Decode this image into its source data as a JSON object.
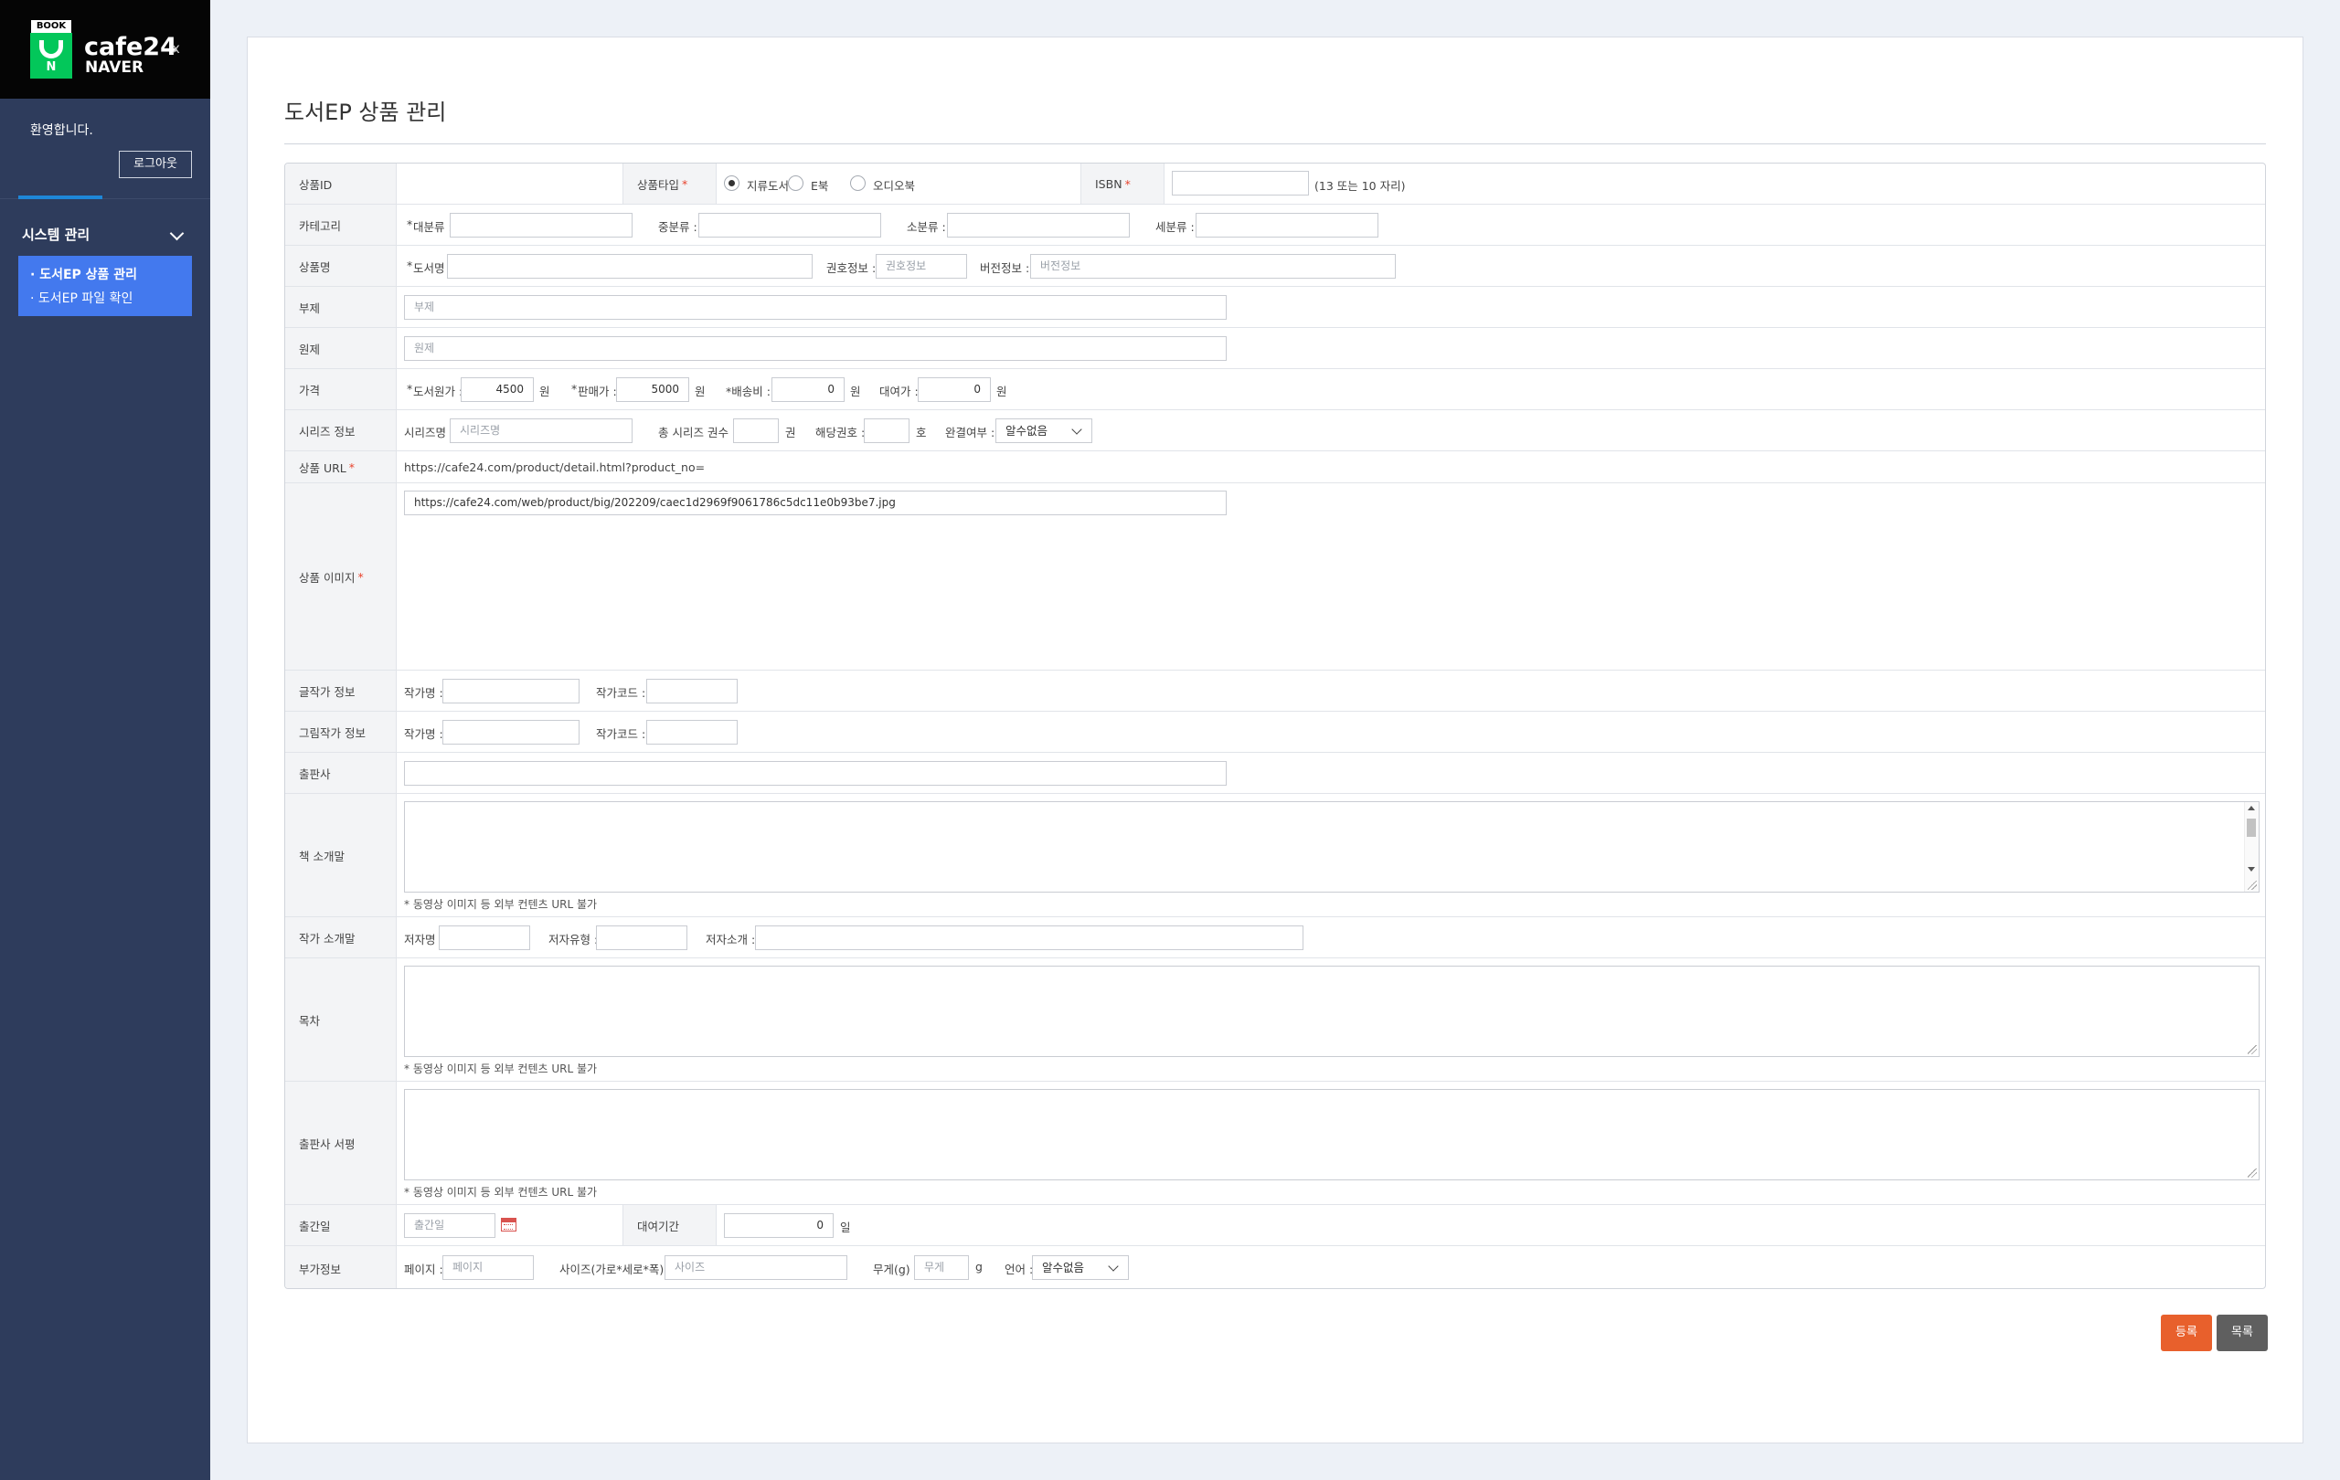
{
  "sidebar": {
    "logo": {
      "badge": "BOOK",
      "n_letter": "N",
      "brand": "cafe24",
      "partner": "NAVER",
      "close": "x"
    },
    "welcome": "환영합니다.",
    "logout_label": "로그아웃",
    "menu_title": "시스템 관리",
    "items": [
      {
        "label": "· 도서EP 상품 관리"
      },
      {
        "label": "· 도서EP 파일 확인"
      }
    ]
  },
  "page": {
    "title": "도서EP 상품 관리"
  },
  "form": {
    "product_id": {
      "label": "상품ID",
      "value": ""
    },
    "product_type": {
      "label": "상품타입",
      "required": "*",
      "options": [
        "지류도서",
        "E북",
        "오디오북"
      ],
      "selected": "지류도서"
    },
    "isbn": {
      "label": "ISBN",
      "required": "*",
      "value": "",
      "hint": "(13 또는 10 자리)"
    },
    "category": {
      "label": "카테고리",
      "required": "*",
      "large": "대분류 :",
      "medium": "중분류 :",
      "small": "소분류 :",
      "detail": "세분류 :"
    },
    "name": {
      "label": "상품명",
      "required": "*",
      "book_name": "도서명 :",
      "volume_label": "권호정보 :",
      "volume_placeholder": "권호정보",
      "version_label": "버전정보 :",
      "version_placeholder": "버전정보"
    },
    "subtitle": {
      "label": "부제",
      "placeholder": "부제"
    },
    "original_title": {
      "label": "원제",
      "placeholder": "원제"
    },
    "price": {
      "label": "가격",
      "required": "*",
      "list_price_label": "도서원가 :",
      "list_price": "4500",
      "sale_price_label": "판매가 :",
      "sale_price": "5000",
      "shipping_label": "*배송비 :",
      "shipping": "0",
      "rental_label": "대여가 :",
      "rental": "0",
      "unit": "원"
    },
    "series": {
      "label": "시리즈 정보",
      "name_label": "시리즈명 :",
      "name_placeholder": "시리즈명",
      "total_label": "총 시리즈 권수 :",
      "total_unit": "권",
      "number_label": "해당권호 :",
      "number_unit": "호",
      "complete_label": "완결여부 :",
      "complete_value": "알수없음"
    },
    "url": {
      "label": "상품 URL",
      "required": "*",
      "value": "https://cafe24.com/product/detail.html?product_no="
    },
    "image": {
      "label": "상품 이미지",
      "required": "*",
      "value": "https://cafe24.com/web/product/big/202209/caec1d2969f9061786c5dc11e0b93be7.jpg"
    },
    "writer": {
      "label": "글작가 정보",
      "name_label": "작가명 :",
      "code_label": "작가코드 :"
    },
    "illustrator": {
      "label": "그림작가 정보",
      "name_label": "작가명 :",
      "code_label": "작가코드 :"
    },
    "publisher": {
      "label": "출판사",
      "value": ""
    },
    "book_intro": {
      "label": "책 소개말",
      "note": "* 동영상 이미지 등 외부 컨텐츠 URL 불가"
    },
    "author_intro": {
      "label": "작가 소개말",
      "name_label": "저자명 :",
      "type_label": "저자유형 :",
      "intro_label": "저자소개 :"
    },
    "toc": {
      "label": "목차",
      "note": "* 동영상 이미지 등 외부 컨텐츠 URL 불가"
    },
    "review": {
      "label": "출판사 서평",
      "note": "* 동영상 이미지 등 외부 컨텐츠 URL 불가"
    },
    "pub_date": {
      "label": "출간일",
      "placeholder": "출간일"
    },
    "rental_period": {
      "label": "대여기간",
      "value": "0",
      "unit": "일"
    },
    "extra": {
      "label": "부가정보",
      "page_label": "페이지 :",
      "page_placeholder": "페이지",
      "size_label": "사이즈(가로*세로*폭) :",
      "size_placeholder": "사이즈",
      "weight_label": "무게(g) :",
      "weight_placeholder": "무게",
      "weight_unit": "g",
      "lang_label": "언어 :",
      "lang_value": "알수없음"
    }
  },
  "buttons": {
    "register": "등록",
    "list": "목록"
  },
  "colors": {
    "accent_blue": "#4379ee",
    "sidebar_bg": "#2e3c5c",
    "register_orange": "#e8602c",
    "naver_green": "#03c75a",
    "required_red": "#e8432d"
  }
}
